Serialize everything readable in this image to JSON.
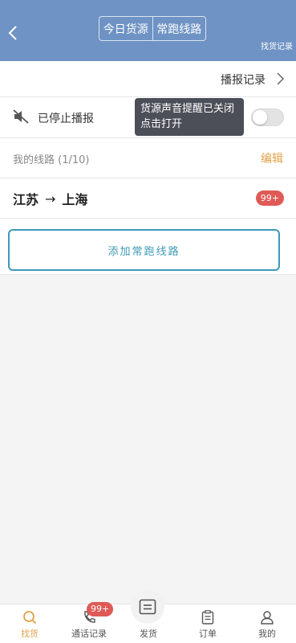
{
  "header": {
    "tabs": [
      {
        "label": "今日货源"
      },
      {
        "label": "常跑线路"
      }
    ],
    "find_record": "找货记录",
    "bg_color": "#6f93c4"
  },
  "broadcast_record": {
    "label": "播报记录",
    "icon": "chevron-right-icon"
  },
  "stopped": {
    "label": "已停止播报",
    "icon": "mute-icon",
    "toggle_on": false
  },
  "tooltip": {
    "line1": "货源声音提醒已关闭",
    "line2": "点击打开"
  },
  "my_routes": {
    "label": "我的线路 (1/10)",
    "edit": "编辑"
  },
  "route": {
    "from": "江苏",
    "arrow": "→",
    "to": "上海",
    "badge": "99+"
  },
  "add_route": {
    "label": "添加常跑线路"
  },
  "tabbar": {
    "tabs": [
      {
        "label": "找货",
        "icon": "search-icon",
        "active": true
      },
      {
        "label": "通话记录",
        "icon": "phone-icon",
        "badge": "99+"
      },
      {
        "label": "发货",
        "icon": "publish-icon"
      },
      {
        "label": "订单",
        "icon": "order-icon"
      },
      {
        "label": "我的",
        "icon": "user-icon"
      }
    ]
  },
  "colors": {
    "accent": "#e3a049",
    "teal": "#3d9ab7",
    "badge": "#df5a56"
  }
}
